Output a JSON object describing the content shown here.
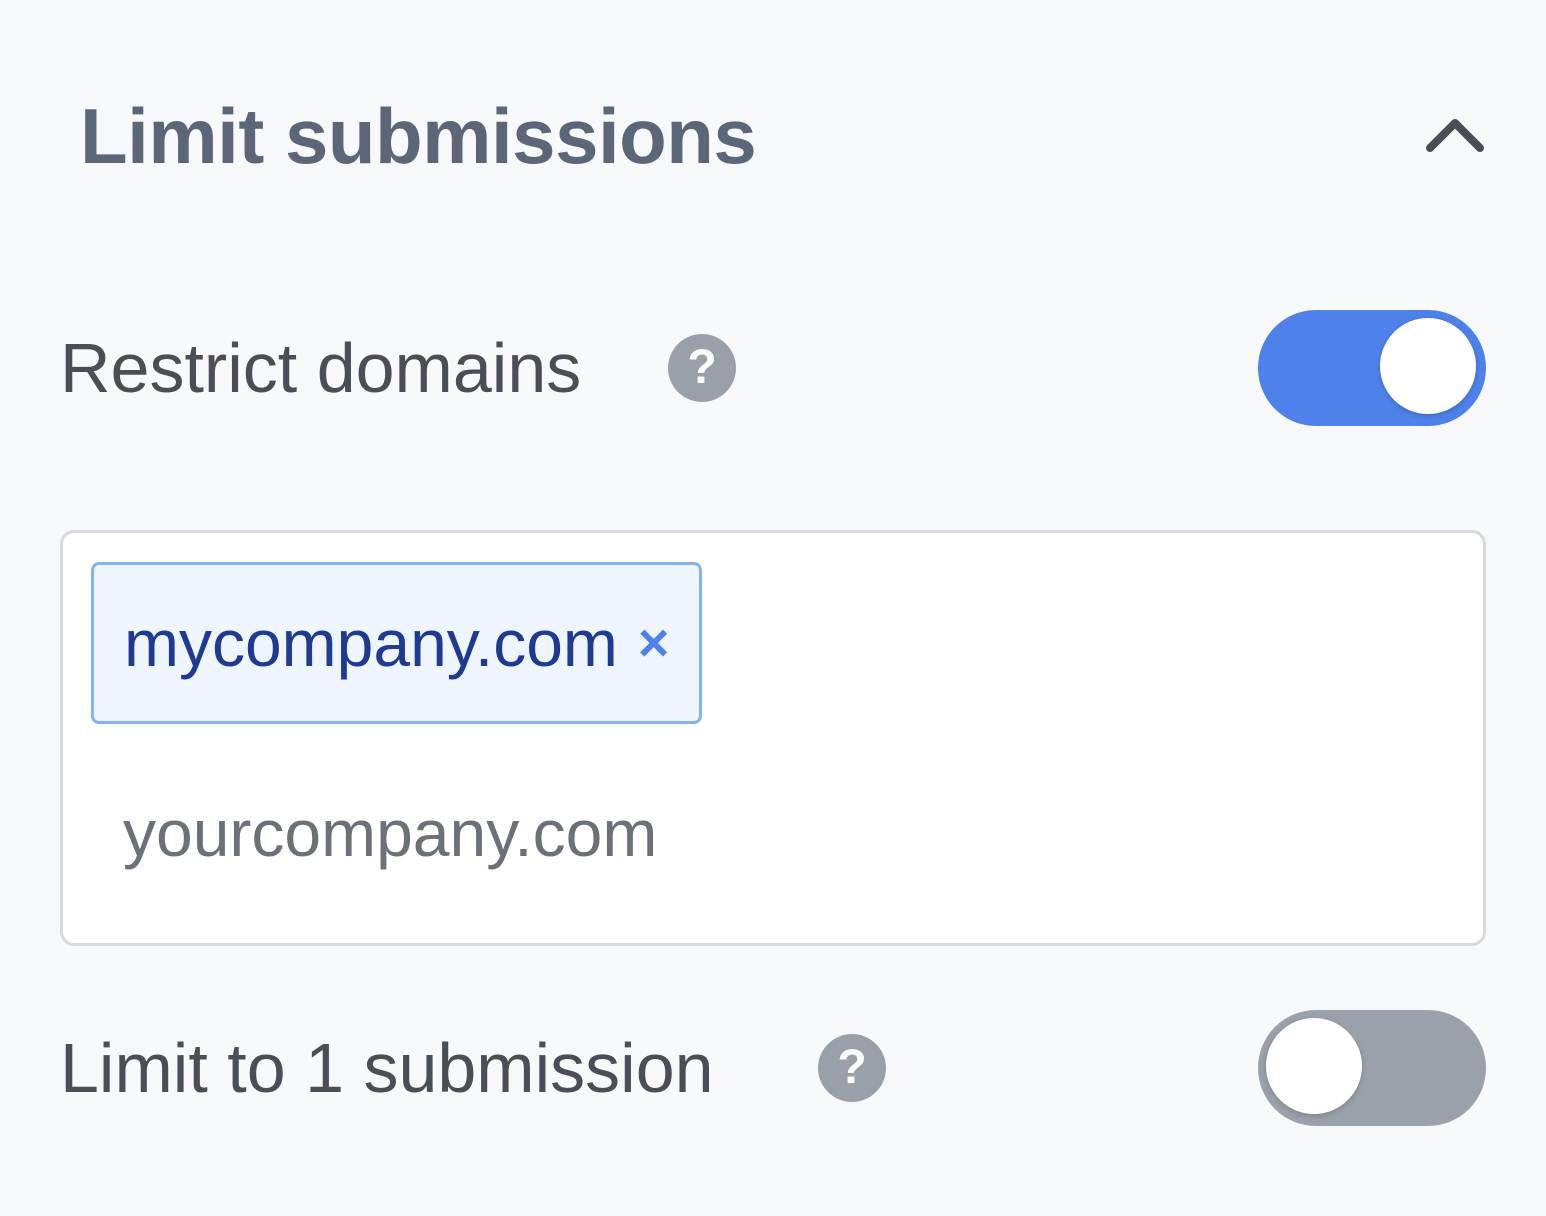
{
  "section": {
    "title": "Limit submissions",
    "collapse_icon": "chevron-up-icon"
  },
  "settings": {
    "restrict_domains": {
      "label": "Restrict domains",
      "help_icon": "question-circle-icon",
      "help_glyph": "?",
      "enabled": true,
      "domains": [
        {
          "value": "mycompany.com",
          "remove_glyph": "×"
        }
      ],
      "input_placeholder": "yourcompany.com"
    },
    "limit_one": {
      "label": "Limit to 1 submission",
      "help_icon": "question-circle-icon",
      "help_glyph": "?",
      "enabled": false
    }
  },
  "colors": {
    "toggle_on": "#4e82ea",
    "toggle_off": "#9ba1aa",
    "tag_background": "#eef5ff",
    "tag_border": "#86b1f3",
    "tag_text": "#1f3a93",
    "title_text": "#5b6779"
  }
}
